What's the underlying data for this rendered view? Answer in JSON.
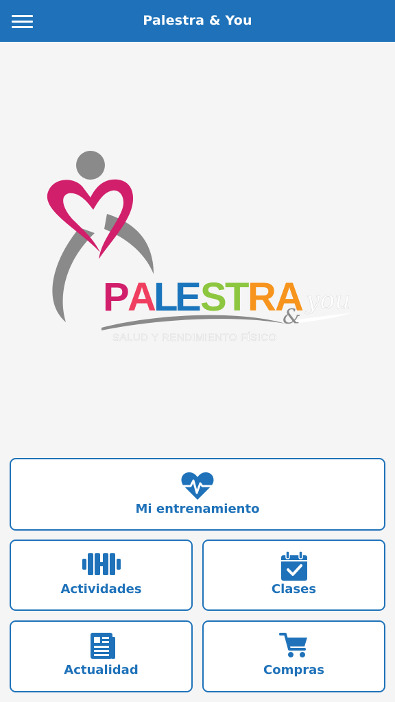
{
  "header": {
    "title": "Palestra & You",
    "menu_icon": "hamburger-menu-icon"
  },
  "logo": {
    "wordmark": "PALESTRA",
    "suffix_and": "&",
    "suffix_you": "you",
    "tagline": "SALUD Y RENDIMIENTO FÍSICO",
    "colors": {
      "heart": "#d11f6b",
      "figure": "#8a8a8a",
      "letter_P": "#d11f6b",
      "letter_A1": "#ef3e5f",
      "letter_L": "#1b75bc",
      "letter_E": "#1b75bc",
      "letter_S": "#8dc63f",
      "letter_T": "#8dc63f",
      "letter_R": "#f7941d",
      "letter_A2": "#f7941d",
      "you": "#ffffff"
    }
  },
  "tiles": {
    "training": {
      "label": "Mi entrenamiento",
      "icon": "heart-pulse-icon"
    },
    "activities": {
      "label": "Actividades",
      "icon": "dumbbell-icon"
    },
    "classes": {
      "label": "Clases",
      "icon": "calendar-check-icon"
    },
    "news": {
      "label": "Actualidad",
      "icon": "newspaper-icon"
    },
    "shop": {
      "label": "Compras",
      "icon": "shopping-cart-icon"
    }
  },
  "theme": {
    "primary": "#1f72b9",
    "background": "#f5f5f5"
  }
}
